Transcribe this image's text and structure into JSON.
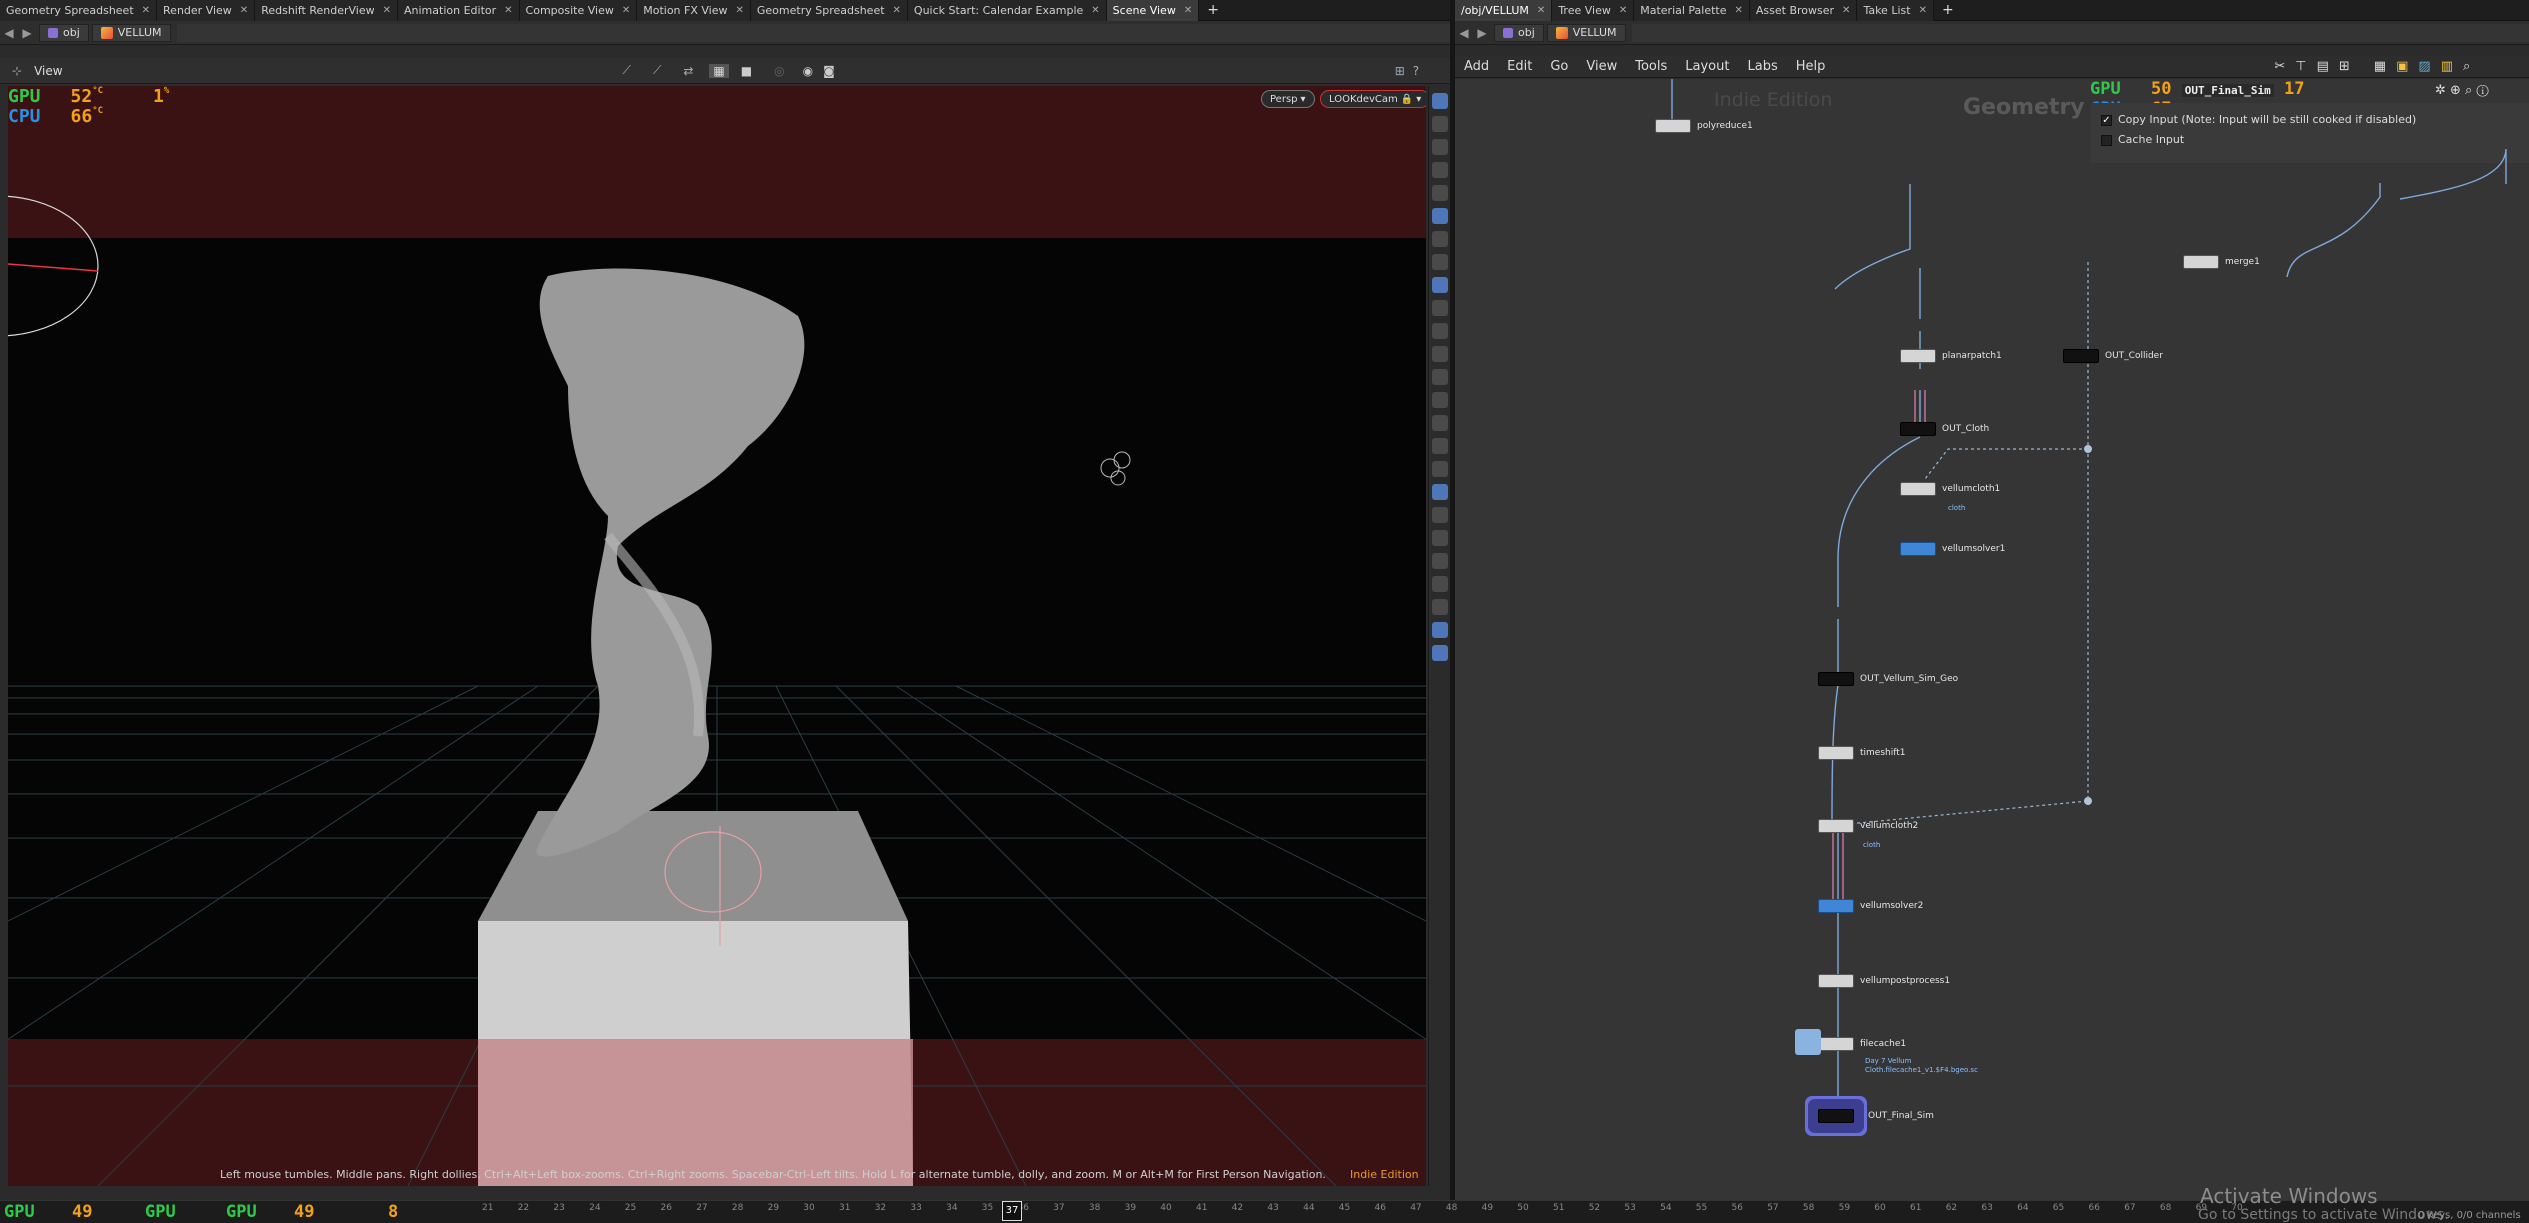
{
  "left_tabs": [
    {
      "label": "Geometry Spreadsheet"
    },
    {
      "label": "Render View"
    },
    {
      "label": "Redshift RenderView"
    },
    {
      "label": "Animation Editor"
    },
    {
      "label": "Composite View"
    },
    {
      "label": "Motion FX View"
    },
    {
      "label": "Geometry Spreadsheet"
    },
    {
      "label": "Quick Start: Calendar Example"
    },
    {
      "label": "Scene View"
    }
  ],
  "right_tabs": [
    {
      "label": "/obj/VELLUM"
    },
    {
      "label": "Tree View"
    },
    {
      "label": "Material Palette"
    },
    {
      "label": "Asset Browser"
    },
    {
      "label": "Take List"
    }
  ],
  "left_path": {
    "root": "obj",
    "node": "VELLUM"
  },
  "right_path": {
    "root": "obj",
    "node": "VELLUM"
  },
  "viewer": {
    "title": "View",
    "persp_label": "Persp",
    "camera_label": "LOOKdevCam",
    "status_text": "Left mouse tumbles. Middle pans. Right dollies. Ctrl+Alt+Left box-zooms. Ctrl+Right zooms. Spacebar-Ctrl-Left tilts. Hold L for alternate tumble, dolly, and zoom.    M or Alt+M for First Person Navigation.",
    "indie_label": "Indie Edition",
    "gpu_label": "GPU",
    "gpu_temp": "52",
    "gpu_pct": "1",
    "cpu_label": "CPU",
    "cpu_temp": "66",
    "temp_unit": "°C",
    "pct_unit": "%"
  },
  "network": {
    "menu": [
      "Add",
      "Edit",
      "Go",
      "View",
      "Tools",
      "Layout",
      "Labs",
      "Help"
    ],
    "watermark": "Indie Edition",
    "context_label": "Geometry",
    "gpu_label": "GPU",
    "gpu_temp": "50",
    "cpu_label": "CPU",
    "cpu_temp": "67",
    "pct": "17",
    "node_name_field": "OUT_Final_Sim",
    "parm_copy_input": "Copy Input (Note: Input will be still cooked if disabled)",
    "parm_cache_input": "Cache Input",
    "nodes": [
      {
        "name": "polyreduce1"
      },
      {
        "name": "merge1"
      },
      {
        "name": "planarpatch1"
      },
      {
        "name": "OUT_Collider"
      },
      {
        "name": "OUT_Cloth"
      },
      {
        "name": "vellumcloth1",
        "sub": "cloth"
      },
      {
        "name": "vellumsolver1"
      },
      {
        "name": "OUT_Vellum_Sim_Geo"
      },
      {
        "name": "timeshift1"
      },
      {
        "name": "vellumcloth2",
        "sub": "cloth"
      },
      {
        "name": "vellumsolver2"
      },
      {
        "name": "vellumpostprocess1"
      },
      {
        "name": "filecache1",
        "sub": "Day 7 Vellum",
        "sub2": "Cloth.filecache1_v1.$F4.bgeo.sc"
      },
      {
        "name": "OUT_Final_Sim"
      }
    ]
  },
  "timeline": {
    "gpu_label": "GPU",
    "gpu_temp": "49",
    "gpu2_temp": "49",
    "pct": "8",
    "current_frame": "37",
    "ticks": [
      "21",
      "22",
      "23",
      "24",
      "25",
      "26",
      "27",
      "28",
      "29",
      "30",
      "31",
      "32",
      "33",
      "34",
      "35",
      "36",
      "37",
      "38",
      "39",
      "40",
      "41",
      "42",
      "43",
      "44",
      "45",
      "46",
      "47",
      "48",
      "49",
      "50",
      "51",
      "52",
      "53",
      "54",
      "55",
      "56",
      "57",
      "58",
      "59",
      "60",
      "61",
      "62",
      "63",
      "64",
      "65",
      "66",
      "67",
      "68",
      "69",
      "70"
    ],
    "keys_label": "0 keys, 0/0 channels"
  },
  "os": {
    "activate_title": "Activate Windows",
    "activate_sub": "Go to Settings to activate Windows."
  }
}
